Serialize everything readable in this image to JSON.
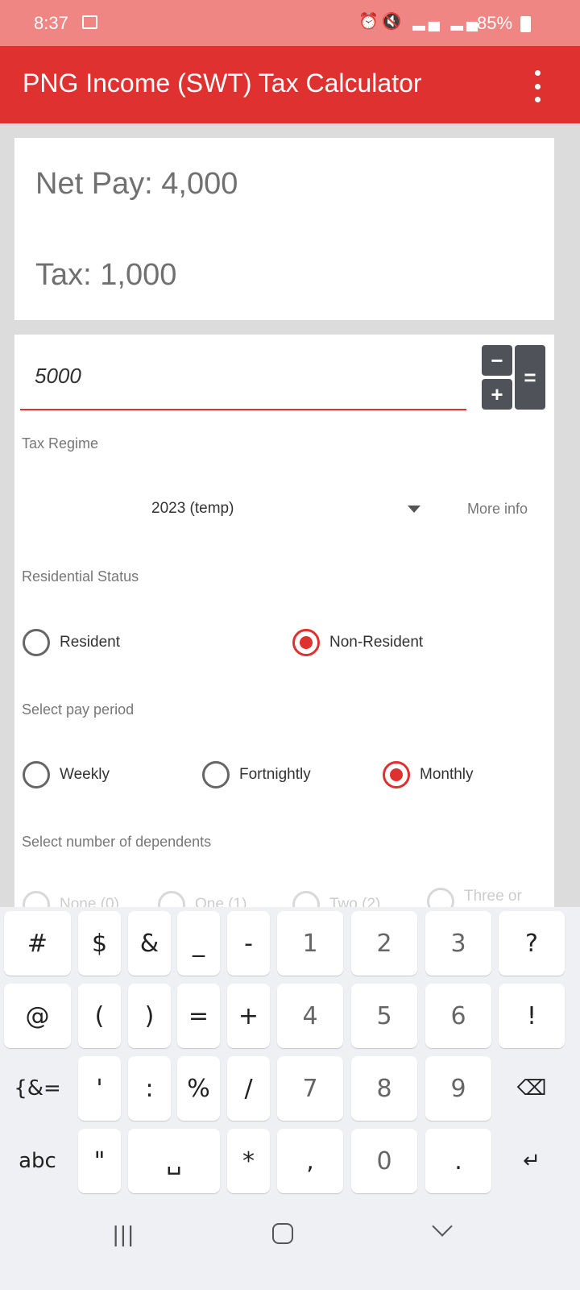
{
  "status": {
    "time": "8:37",
    "battery": "85%"
  },
  "appbar": {
    "title": "PNG Income (SWT) Tax Calculator"
  },
  "results": {
    "net_pay": "Net Pay: 4,000",
    "tax": "Tax: 1,000"
  },
  "form": {
    "amount_value": "5000",
    "calc": {
      "minus": "−",
      "plus": "+",
      "equals": "="
    },
    "tax_regime_label": "Tax Regime",
    "tax_regime_value": "2023 (temp)",
    "more_info": "More info",
    "residential_label": "Residential Status",
    "residential_options": [
      {
        "label": "Resident",
        "selected": false
      },
      {
        "label": "Non-Resident",
        "selected": true
      }
    ],
    "pay_period_label": "Select pay period",
    "pay_period_options": [
      {
        "label": "Weekly",
        "selected": false
      },
      {
        "label": "Fortnightly",
        "selected": false
      },
      {
        "label": "Monthly",
        "selected": true
      }
    ],
    "dependents_label": "Select number of dependents",
    "dependents_options": [
      {
        "label": "None (0)"
      },
      {
        "label": "One (1)"
      },
      {
        "label": "Two (2)"
      },
      {
        "label": "Three or"
      }
    ]
  },
  "accent": "#e03131",
  "keyboard": {
    "rows": [
      [
        "#",
        "$",
        "&",
        "_",
        "-",
        "1",
        "2",
        "3",
        "?"
      ],
      [
        "@",
        "(",
        ")",
        "=",
        "+",
        "4",
        "5",
        "6",
        "!"
      ],
      [
        "{&=",
        "'",
        ":",
        "%",
        "/",
        "7",
        "8",
        "9",
        "⌫"
      ],
      [
        "abc",
        "\"",
        "␣",
        "*",
        ",",
        "0",
        ".",
        "↵"
      ]
    ]
  }
}
